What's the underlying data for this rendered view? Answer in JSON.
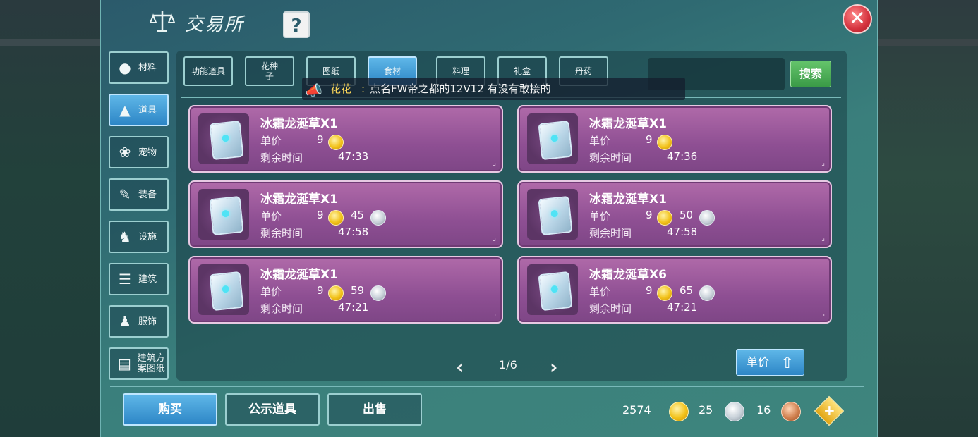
{
  "header": {
    "title": "交易所",
    "help_label": "?",
    "close_label": "✕"
  },
  "sidebar": {
    "items": [
      {
        "label": "材料",
        "icon": "materials-icon",
        "active": false
      },
      {
        "label": "道具",
        "icon": "tool-icon",
        "active": true
      },
      {
        "label": "宠物",
        "icon": "paw-icon",
        "active": false
      },
      {
        "label": "装备",
        "icon": "equipment-icon",
        "active": false
      },
      {
        "label": "设施",
        "icon": "facility-icon",
        "active": false
      },
      {
        "label": "建筑",
        "icon": "building-icon",
        "active": false
      },
      {
        "label": "服饰",
        "icon": "clothing-icon",
        "active": false
      },
      {
        "label": "建筑方案图纸",
        "icon": "blueprint-icon",
        "active": false
      }
    ]
  },
  "tabs": [
    {
      "label": "功能道具",
      "active": false
    },
    {
      "label": "花种子",
      "active": false
    },
    {
      "label": "图纸",
      "active": false
    },
    {
      "label": "食材",
      "active": true
    },
    {
      "label": "料理",
      "active": false
    },
    {
      "label": "礼盒",
      "active": false
    },
    {
      "label": "丹药",
      "active": false
    }
  ],
  "search": {
    "button_label": "搜索",
    "value": ""
  },
  "ticker": {
    "name": "花花",
    "message": "点名FW帝之都的12V12 有没有敢接的"
  },
  "listings": [
    {
      "name": "冰霜龙涎草X1",
      "price_label": "单价",
      "gold": "9",
      "silver": "",
      "time_label": "剩余时间",
      "time": "47:33"
    },
    {
      "name": "冰霜龙涎草X1",
      "price_label": "单价",
      "gold": "9",
      "silver": "",
      "time_label": "剩余时间",
      "time": "47:36"
    },
    {
      "name": "冰霜龙涎草X1",
      "price_label": "单价",
      "gold": "9",
      "silver": "45",
      "time_label": "剩余时间",
      "time": "47:58"
    },
    {
      "name": "冰霜龙涎草X1",
      "price_label": "单价",
      "gold": "9",
      "silver": "50",
      "time_label": "剩余时间",
      "time": "47:58"
    },
    {
      "name": "冰霜龙涎草X1",
      "price_label": "单价",
      "gold": "9",
      "silver": "59",
      "time_label": "剩余时间",
      "time": "47:21"
    },
    {
      "name": "冰霜龙涎草X6",
      "price_label": "单价",
      "gold": "9",
      "silver": "65",
      "time_label": "剩余时间",
      "time": "47:21"
    }
  ],
  "pagination": {
    "page": "1/6",
    "prev": "‹",
    "next": "›"
  },
  "sort": {
    "label": "单价"
  },
  "actions": {
    "buy": "购买",
    "public": "公示道具",
    "sell": "出售"
  },
  "currency": {
    "gold": "2574",
    "silver": "25",
    "bronze": "16"
  },
  "colors": {
    "accent_blue": "#2d86c6",
    "card_purple": "#8e4f93",
    "search_green": "#3a9a47",
    "close_red": "#d4313d"
  }
}
